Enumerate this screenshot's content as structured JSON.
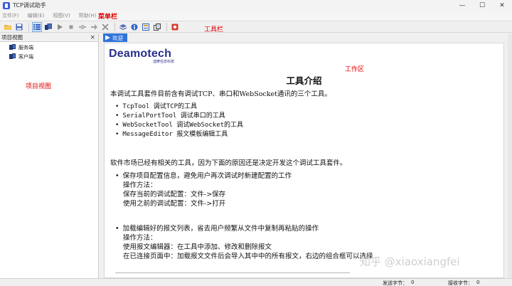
{
  "window": {
    "title": "TCP调试助手",
    "minimize": "—",
    "maximize": "☐",
    "close": "✕"
  },
  "menubar": {
    "items": [
      "文件(F)",
      "编辑(E)",
      "视图(V)",
      "帮助(H)"
    ],
    "annotation": "菜单栏"
  },
  "toolbar": {
    "annotation": "工具栏",
    "buttons": [
      "open-folder-icon",
      "save-icon",
      "list-view-icon",
      "server-icon",
      "play-icon",
      "stop-icon",
      "disconnect-icon",
      "send-icon",
      "delete-icon",
      "layers-icon",
      "help-icon",
      "message-edit-icon",
      "copy-icon",
      "record-icon"
    ]
  },
  "project_view": {
    "title": "项目视图",
    "close": "×",
    "items": [
      "服务端",
      "客户端"
    ],
    "annotation": "项目视图"
  },
  "work_area": {
    "tab": "欢迎",
    "annotation": "工作区",
    "logo": "Deamotech",
    "logo_sub": "迪摩信息科技",
    "title": "工具介绍",
    "intro": "本调试工具套件目前含有调试TCP、串口和WebSocket通讯的三个工具。",
    "tools": [
      "TcpTool 调试TCP的工具",
      "SerialPortTool 调试串口的工具",
      "WebSocketTool 调试WebSocket的工具",
      "MessageEditor 报文模板编辑工具"
    ],
    "reason": "软件市场已经有相关的工具，因为下面的原因还是决定开发这个调试工具套件。",
    "point1": "保存项目配置信息，避免用户再次调试时新建配置的工作",
    "point1_lines": [
      "操作方法：",
      "保存当前的调试配置：文件->保存",
      "使用之前的调试配置：文件->打开"
    ],
    "point2": "加载编辑好的报文列表，省去用户频繁从文件中复制再粘贴的操作",
    "point2_lines": [
      "操作方法：",
      "使用报文编辑器：在工具中添加、修改和删除报文",
      "在已连接页面中：加载报文文件后会导入其中中的所有报文，右边的组合框可以选择"
    ]
  },
  "watermark": "知乎 @xiaoxiangfei",
  "statusbar": {
    "sent_label": "发送字节：",
    "sent_value": "0",
    "recv_label": "接收字节：",
    "recv_value": "0"
  },
  "colors": {
    "accent": "#2e74d9",
    "annotation": "#e00000",
    "logo": "#2a2f8f"
  }
}
